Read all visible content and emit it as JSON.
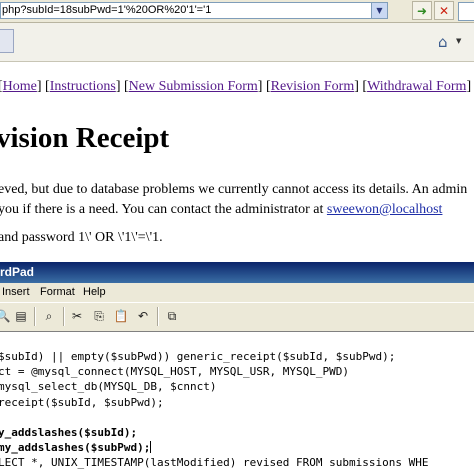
{
  "browser": {
    "address_url": "php?subId=18subPwd=1'%20OR%20'1'='1",
    "go_icon": "go-arrow-icon",
    "stop_icon": "stop-x-icon",
    "home_icon": "home-icon"
  },
  "page": {
    "nav_links": [
      {
        "label": "Home"
      },
      {
        "label": "Instructions"
      },
      {
        "label": "New Submission Form"
      },
      {
        "label": "Revision Form"
      },
      {
        "label": "Withdrawal Form"
      }
    ],
    "title": "vision Receipt",
    "para_line1": "eved, but due to database problems we currently cannot access its details. An admin",
    "para_line2_prefix": "you if there is a need. You can contact the administrator at ",
    "admin_email": "sweewon@localhost",
    "password_line": "and password 1\\' OR \\'1\\'=\\'1."
  },
  "wordpad": {
    "title": "rdPad",
    "menu": [
      "Insert",
      "Format",
      "Help"
    ],
    "toolbar_icons": [
      "print-preview-icon",
      "find-icon",
      "cut-icon",
      "copy-icon",
      "paste-icon",
      "undo-icon",
      "insert-object-icon"
    ],
    "code_lines": [
      "$subId) || empty($subPwd)) generic_receipt($subId, $subPwd);",
      "ct = @mysql_connect(MYSQL_HOST, MYSQL_USR, MYSQL_PWD)",
      "mysql_select_db(MYSQL_DB, $cnnct)",
      "receipt($subId, $subPwd);",
      "",
      "y_addslashes($subId);",
      "my_addslashes($subPwd);",
      "LECT *, UNIX_TIMESTAMP(lastModified) revised FROM submissions WHE"
    ]
  }
}
